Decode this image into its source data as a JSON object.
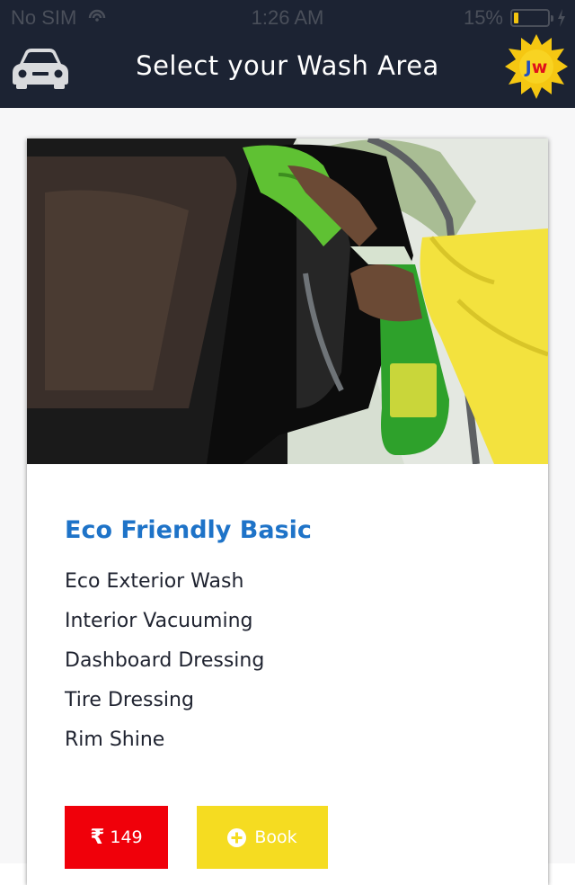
{
  "status_bar": {
    "carrier": "No SIM",
    "time": "1:26 AM",
    "battery_percent": "15%",
    "battery_level": 0.15,
    "battery_color": "#f2c40f"
  },
  "header": {
    "title": "Select your Wash Area",
    "left_icon": "car-icon",
    "logo_text": "Jw",
    "background": "#1c2333"
  },
  "card": {
    "title": "Eco Friendly Basic",
    "features": [
      "Eco Exterior Wash",
      "Interior Vacuuming",
      "Dashboard Dressing",
      "Tire Dressing",
      "Rim Shine"
    ],
    "price": {
      "currency_symbol": "₹",
      "amount": "149",
      "color": "#f0000a"
    },
    "book_button": {
      "label": "Book",
      "icon": "plus-circle-icon",
      "color": "#f5dc21"
    },
    "title_color": "#1e73c8"
  }
}
